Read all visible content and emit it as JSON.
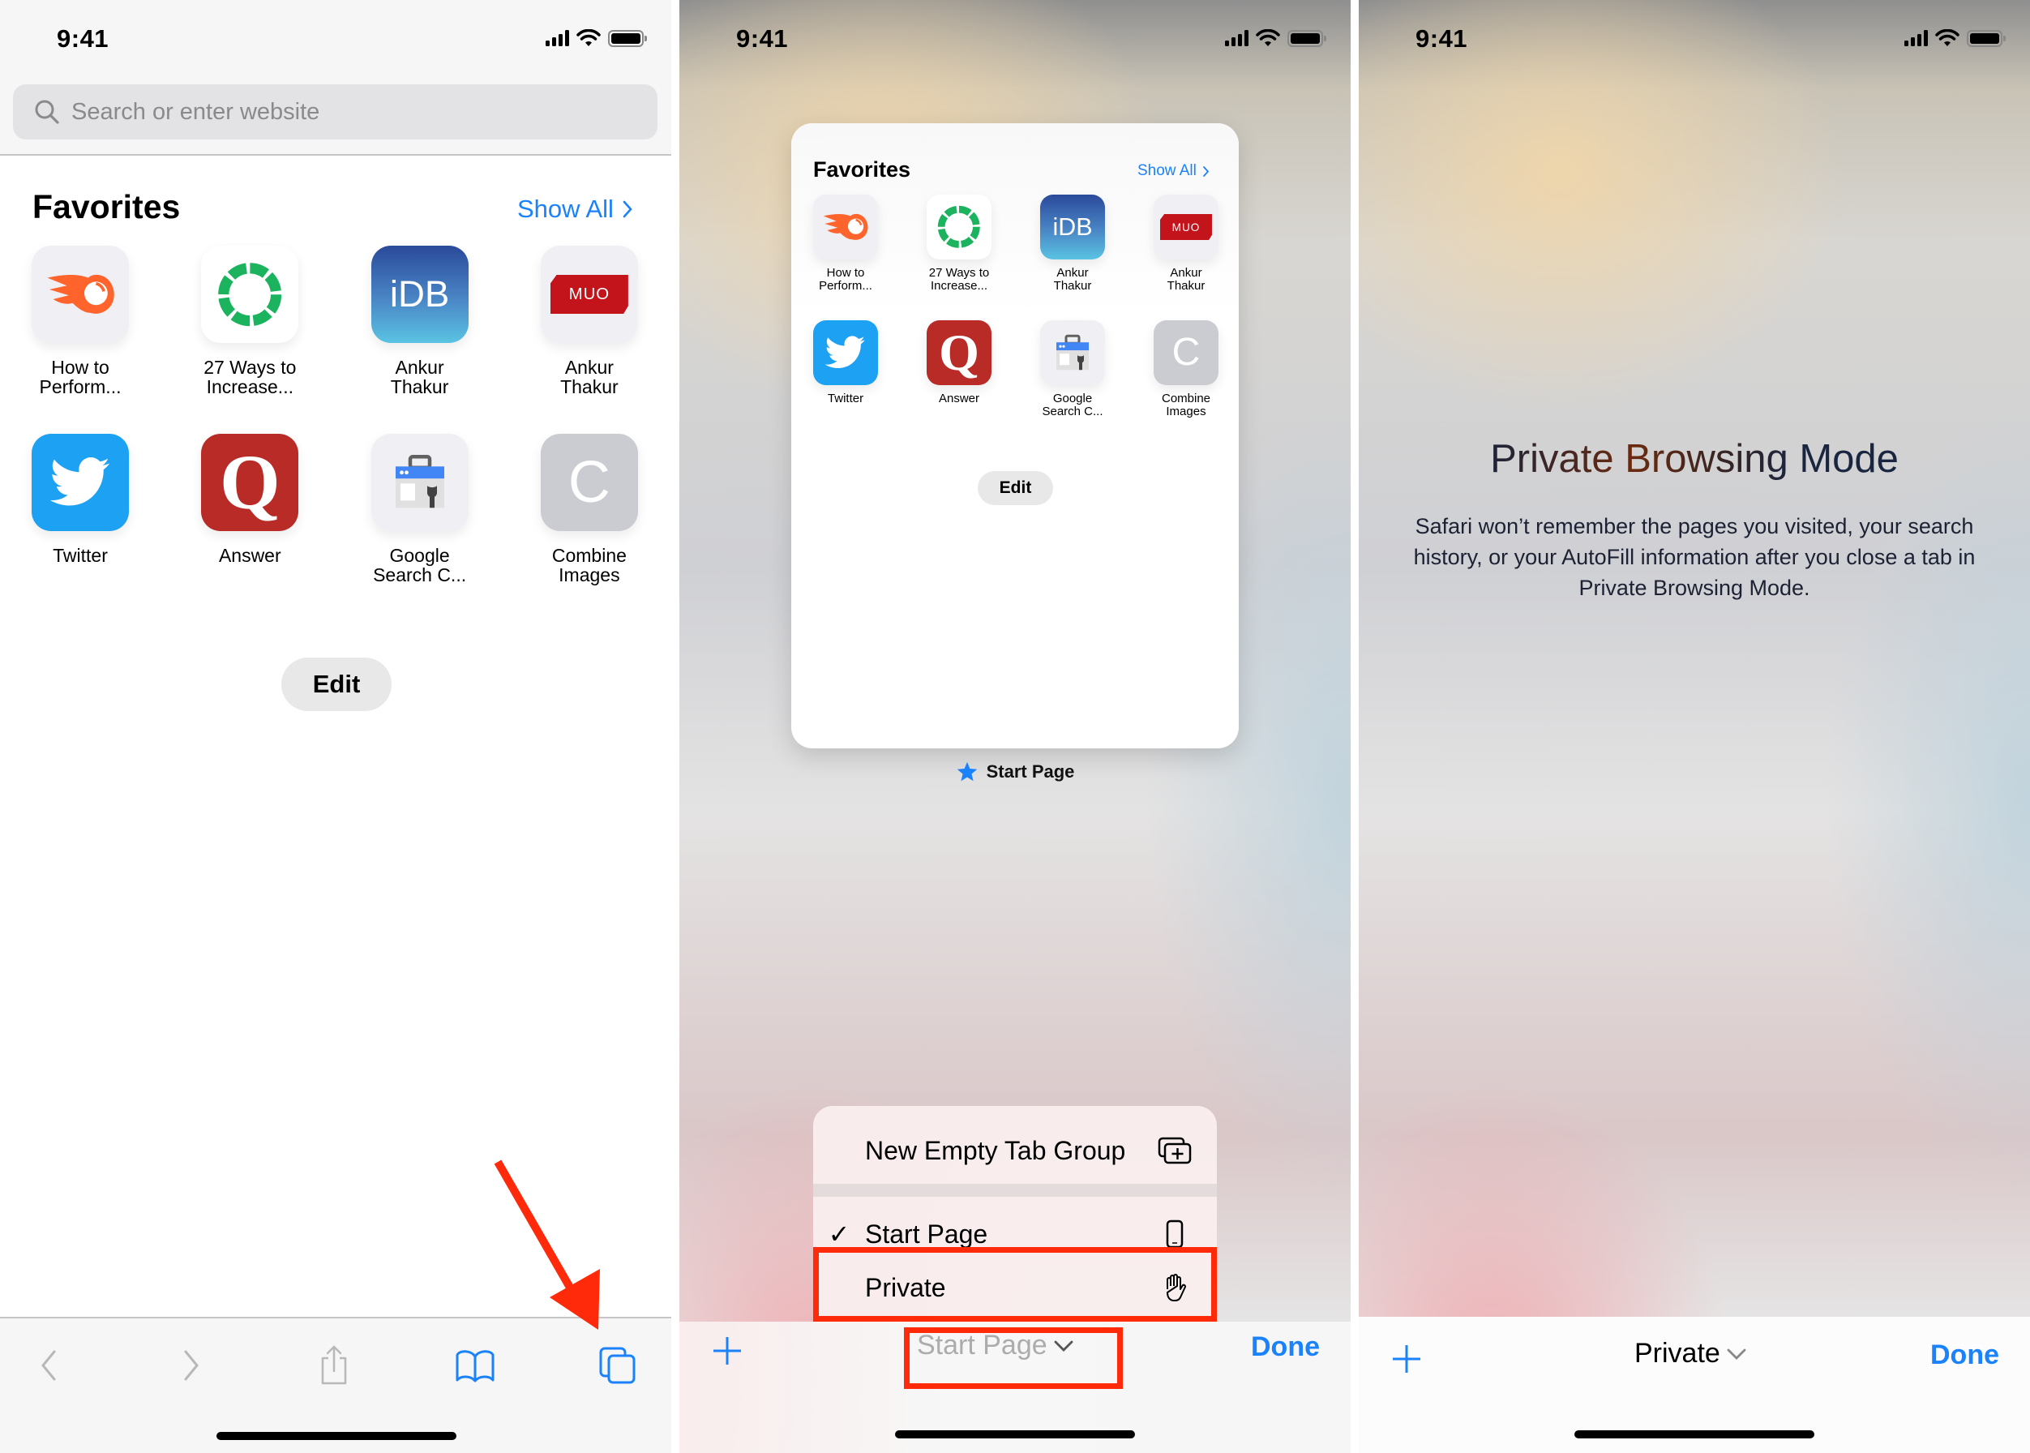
{
  "status_bar": {
    "time": "9:41"
  },
  "panel1": {
    "search": {
      "placeholder": "Search or enter website",
      "value": ""
    },
    "favorites_title": "Favorites",
    "show_all": "Show All",
    "favorites": [
      {
        "label": "How to\nPerform...",
        "icon": "semrush-icon",
        "bg": "#f0f0f4"
      },
      {
        "label": "27 Ways to\nIncrease...",
        "icon": "green-ring-icon",
        "bg": "#ffffff"
      },
      {
        "label": "Ankur\nThakur",
        "icon": "idb-icon",
        "bg": "#3a6ab5",
        "text": "iDB"
      },
      {
        "label": "Ankur\nThakur",
        "icon": "muo-icon",
        "bg": "#f0f0f4",
        "text": "MUO"
      },
      {
        "label": "Twitter",
        "icon": "twitter-bird-icon",
        "bg": "#1da1f2"
      },
      {
        "label": "Answer",
        "icon": "quora-icon",
        "bg": "#b92b27",
        "text": "Q"
      },
      {
        "label": "Google\nSearch C...",
        "icon": "search-console-icon",
        "bg": "#f0f0f4"
      },
      {
        "label": "Combine\nImages",
        "icon": "letter-c-icon",
        "bg": "#cbccd1",
        "text": "C"
      }
    ],
    "edit_label": "Edit",
    "toolbar": [
      "back",
      "forward",
      "share",
      "bookmarks",
      "tabs"
    ]
  },
  "panel2": {
    "card": {
      "favorites_title": "Favorites",
      "show_all": "Show All",
      "edit_label": "Edit"
    },
    "tab_caption": "Start Page",
    "menu": {
      "items": [
        {
          "label": "New Empty Tab Group",
          "icon": "new-tab-group-icon",
          "checked": false
        },
        {
          "label": "Start Page",
          "icon": "iphone-icon",
          "checked": true
        },
        {
          "label": "Private",
          "icon": "hand-icon",
          "checked": false
        }
      ],
      "check_glyph": "✓"
    },
    "toolbar": {
      "plus": "+",
      "group": "Start Page",
      "done": "Done"
    }
  },
  "panel3": {
    "title": "Private Browsing Mode",
    "body": "Safari won’t remember the pages you visited, your search history, or your AutoFill information after you close a tab in Private Browsing Mode.",
    "toolbar": {
      "plus": "+",
      "group": "Private",
      "done": "Done"
    }
  },
  "colors": {
    "accent": "#1a82fb",
    "annotation_red": "#ff2a0a"
  }
}
